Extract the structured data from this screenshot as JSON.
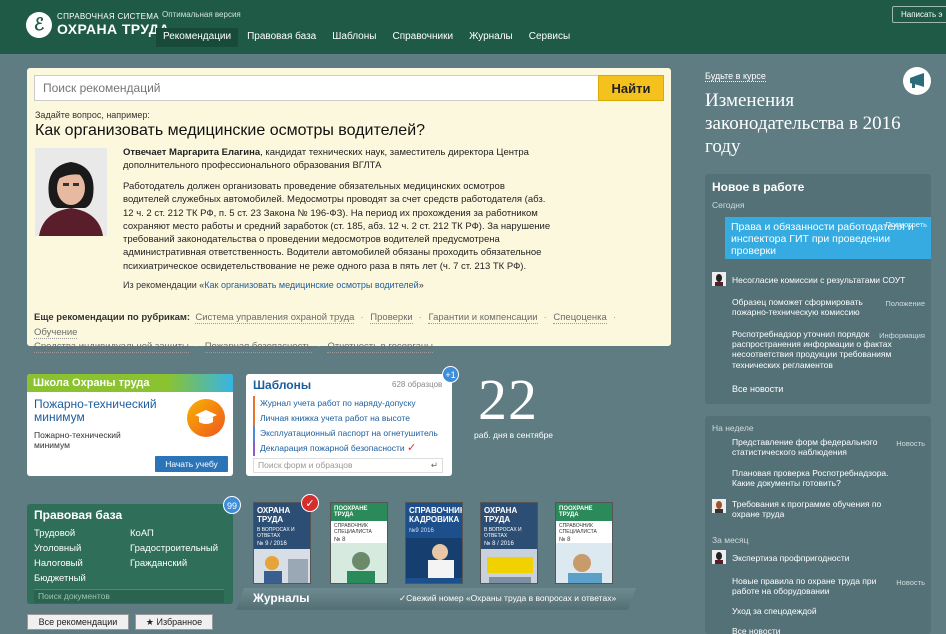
{
  "header": {
    "logo_line1": "СПРАВОЧНАЯ СИСТЕМА",
    "logo_line2": "ОХРАНА ТРУДА",
    "version_label": "Оптимальная версия",
    "write_label": "Написать э",
    "nav": [
      "Рекомендации",
      "Правовая база",
      "Шаблоны",
      "Справочники",
      "Журналы",
      "Сервисы"
    ]
  },
  "search": {
    "placeholder": "Поиск рекомендаций",
    "button": "Найти"
  },
  "question": {
    "hint": "Задайте вопрос, например:",
    "title": "Как организовать медицинские осмотры водителей?",
    "author": "Отвечает Маргарита Елагина",
    "author_info": ", кандидат технических наук, заместитель директора Центра дополнительного профессионального образования ВГЛТА",
    "answer": "Работодатель должен организовать проведение обязательных медицинских осмотров водителей служебных автомобилей. Медосмотры проводят за счет средств работодателя (абз. 12 ч. 2 ст. 212 ТК РФ, п. 5 ст. 23 Закона № 196-ФЗ). На период их прохождения за работником сохраняют место работы и средний заработок (ст. 185, абз. 12 ч. 2 ст. 212 ТК РФ). За нарушение требований законодательства о проведении медосмотров водителей предусмотрена административная ответственность. Водители автомобилей обязаны проходить обязательное психиатрическое освидетельствование не реже одного раза в пять лет (ч. 7 ст. 213 ТК РФ).",
    "from_prefix": "Из рекомендации «",
    "from_link": "Как организовать медицинские осмотры водителей",
    "from_suffix": "»"
  },
  "rubrics": {
    "label": "Еще рекомендации по рубрикам:",
    "items": [
      "Система управления охраной труда",
      "Проверки",
      "Гарантии и компенсации",
      "Спецоценка",
      "Обучение",
      "Средства индивидуальной защиты",
      "Пожарная безопасность",
      "Отчетность в госорганы"
    ]
  },
  "school": {
    "header": "Школа Охраны труда",
    "title": "Пожарно-технический минимум",
    "subtitle": "Пожарно-технический минимум",
    "button": "Начать учебу"
  },
  "templates": {
    "title": "Шаблоны",
    "count": "628 образцов",
    "badge": "+1",
    "items": [
      "Журнал учета работ по наряду-допуску",
      "Личная книжка учета работ на высоте",
      "Эксплуатационный паспорт на огнетушитель",
      "Декларация пожарной безопасности"
    ],
    "search_placeholder": "Поиск форм и образцов"
  },
  "workdays": {
    "number": "22",
    "caption": "раб. дня в сентябре"
  },
  "legal": {
    "title": "Правовая база",
    "badge": "99",
    "links": [
      "Трудовой",
      "КоАП",
      "Уголовный",
      "Градостроительный",
      "Налоговый",
      "Гражданский",
      "Бюджетный"
    ],
    "search_placeholder": "Поиск документов"
  },
  "buttons": {
    "all_recs": "Все рекомендации",
    "favorites": "★ Избранное"
  },
  "journals": {
    "label": "Журналы",
    "fresh": "✓Свежий номер «Охраны труда в вопросах и ответах»",
    "covers": [
      {
        "title": "ОХРАНА ТРУДА",
        "sub": "В ВОПРОСАХ И ОТВЕТАХ",
        "num": "№ 9 / 2016",
        "color": "#2d4e74"
      },
      {
        "title": "ПООХРАНЕ ТРУДА",
        "sub": "СПРАВОЧНИК СПЕЦИАЛИСТА",
        "num": "№ 8",
        "color": "#2a8a5a"
      },
      {
        "title": "СПРАВОЧНИК",
        "sub": "КАДРОВИКА",
        "num": "№9 2016",
        "color": "#1d4f8c"
      },
      {
        "title": "ОХРАНА ТРУДА",
        "sub": "В ВОПРОСАХ И ОТВЕТАХ",
        "num": "№ 8 / 2016",
        "color": "#2d4e74"
      },
      {
        "title": "ПООХРАНЕ ТРУДА",
        "sub": "СПРАВОЧНИК СПЕЦИАЛИСТА",
        "num": "№ 8",
        "color": "#2a8a5a"
      }
    ]
  },
  "sidebar": {
    "course_link": "Будьте в курсе",
    "headline": "Изменения законодательства в 2016 году",
    "news_title": "Новое в работе",
    "today_label": "Сегодня",
    "highlight": "Права и обязанности работодателя и инспектора ГИТ при проведении проверки",
    "highlight_tag": "Посмотреть",
    "items": [
      {
        "text": "Несогласие комиссии с результатами СОУТ",
        "tag": ""
      },
      {
        "text": "Образец поможет сформировать пожарно-техническую комиссию",
        "tag": "Положение"
      },
      {
        "text": "Роспотребнадзор уточнил порядок распространения информации о фактах несоответствия продукции требованиям технических регламентов",
        "tag": "Информация"
      }
    ],
    "all_news": "Все новости",
    "week_label": "На неделе",
    "week_items": [
      {
        "text": "Представление форм федерального статистического наблюдения",
        "tag": "Новость"
      },
      {
        "text": "Плановая проверка Роспотребнадзора. Какие документы готовить?",
        "tag": ""
      },
      {
        "text": "Требования к программе обучения по охране труда",
        "tag": ""
      }
    ],
    "month_label": "За месяц",
    "month_items": [
      {
        "text": "Экспертиза профпригодности",
        "tag": ""
      },
      {
        "text": "Новые правила по охране труда при работе на оборудовании",
        "tag": "Новость"
      },
      {
        "text": "Уход за спецодеждой",
        "tag": ""
      }
    ],
    "all_news2": "Все новости"
  }
}
